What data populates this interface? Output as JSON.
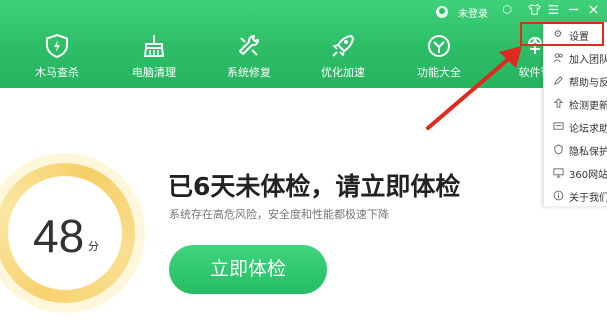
{
  "topbar": {
    "user_label": "未登录",
    "icons": [
      "user-icon",
      "settings-gear-icon",
      "shirt-icon",
      "menu-icon",
      "minimize-icon",
      "close-icon"
    ]
  },
  "nav": {
    "items": [
      {
        "label": "木马查杀",
        "icon": "shield-icon"
      },
      {
        "label": "电脑清理",
        "icon": "broom-icon"
      },
      {
        "label": "系统修复",
        "icon": "wrench-icon"
      },
      {
        "label": "优化加速",
        "icon": "rocket-icon"
      },
      {
        "label": "功能大全",
        "icon": "cube-icon"
      },
      {
        "label": "软件管",
        "icon": "app-store-icon"
      }
    ]
  },
  "main": {
    "score": "48",
    "score_unit": "分",
    "headline": "已6天未体检，请立即体检",
    "subline": "系统存在高危风险，安全度和性能都极速下降",
    "check_button": "立即体检"
  },
  "menu": {
    "items": [
      {
        "label": "设置",
        "icon": "gear-icon"
      },
      {
        "label": "加入团队",
        "icon": "team-icon"
      },
      {
        "label": "帮助与反",
        "icon": "edit-icon"
      },
      {
        "label": "检测更新",
        "icon": "update-icon"
      },
      {
        "label": "论坛求助",
        "icon": "forum-icon"
      },
      {
        "label": "隐私保护",
        "icon": "privacy-icon"
      },
      {
        "label": "360网站",
        "icon": "monitor-icon"
      },
      {
        "label": "关于我们",
        "icon": "info-icon"
      }
    ]
  },
  "colors": {
    "brand_green": "#2dbd67",
    "annotation_red": "#e02a1f",
    "score_ring": "#f7d26f"
  }
}
